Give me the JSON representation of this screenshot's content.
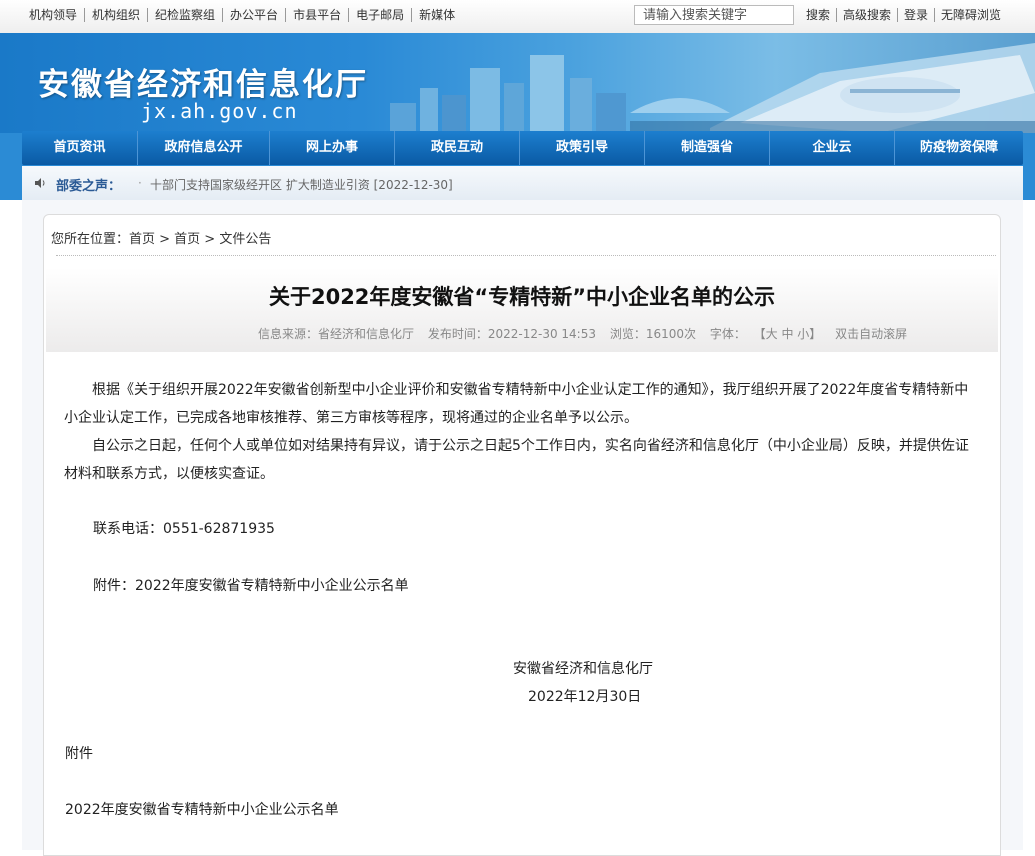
{
  "topbar": {
    "links": [
      "机构领导",
      "机构组织",
      "纪检监察组",
      "办公平台",
      "市县平台",
      "电子邮局",
      "新媒体"
    ],
    "search_placeholder": "请输入搜索关键字",
    "search_button": "搜索",
    "advanced_search": "高级搜索",
    "login": "登录",
    "accessibility": "无障碍浏览"
  },
  "banner": {
    "title": "安徽省经济和信息化厅",
    "domain": "jx.ah.gov.cn"
  },
  "nav": {
    "items": [
      "首页资讯",
      "政府信息公开",
      "网上办事",
      "政民互动",
      "政策引导",
      "制造强省",
      "企业云",
      "防疫物资保障"
    ]
  },
  "notice": {
    "label": "部委之声：",
    "text": "十部门支持国家级经开区 扩大制造业引资 [2022-12-30]"
  },
  "breadcrumb": "您所在位置：首页 > 首页 > 文件公告",
  "article": {
    "title": "关于2022年度安徽省“专精特新”中小企业名单的公示",
    "meta": {
      "source": "信息来源：省经济和信息化厅",
      "date": "发布时间：2022-12-30 14:53",
      "views": "浏览：16100次",
      "font_label": "字体：",
      "font_sizes": "【大 中 小】",
      "autoscroll": "双击自动滚屏"
    },
    "paragraphs": [
      "根据《关于组织开展2022年安徽省创新型中小企业评价和安徽省专精特新中小企业认定工作的通知》，我厅组织开展了2022年度省专精特新中小企业认定工作，已完成各地审核推荐、第三方审核等程序，现将通过的企业名单予以公示。",
      "自公示之日起，任何个人或单位如对结果持有异议，请于公示之日起5个工作日内，实名向省经济和信息化厅（中小企业局）反映，并提供佐证材料和联系方式，以便核实查证。"
    ],
    "contact": "联系电话：0551-62871935",
    "attachment_line": "附件：2022年度安徽省专精特新中小企业公示名单",
    "signature": "安徽省经济和信息化厅",
    "sign_date": "2022年12月30日",
    "appendix_label": "附件",
    "appendix_title": "2022年度安徽省专精特新中小企业公示名单"
  }
}
